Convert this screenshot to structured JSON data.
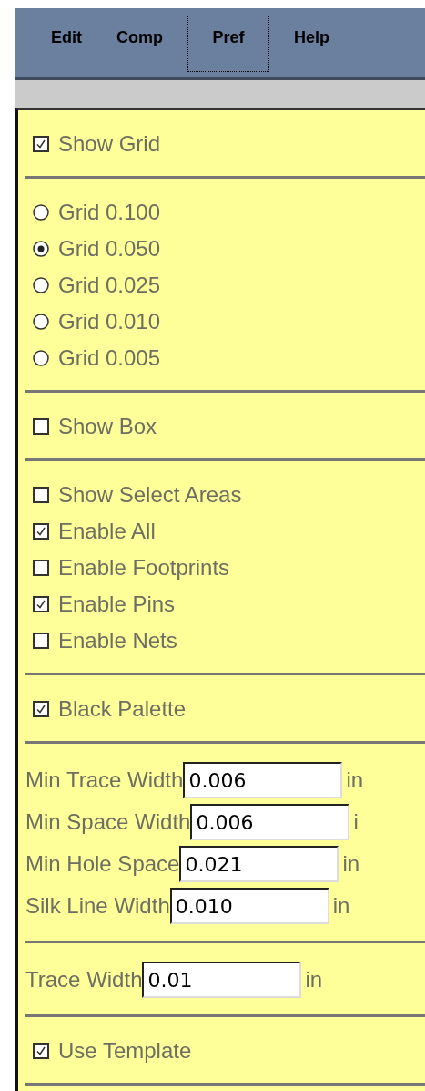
{
  "menu": [
    {
      "label": "Edit",
      "selected": false
    },
    {
      "label": "Comp",
      "selected": false
    },
    {
      "label": "Pref",
      "selected": true
    },
    {
      "label": "Help",
      "selected": false
    }
  ],
  "sections": [
    {
      "kind": "checks",
      "items": [
        {
          "label": "Show Grid",
          "checked": true
        }
      ]
    },
    {
      "kind": "radios",
      "items": [
        {
          "label": "Grid 0.100",
          "selected": false
        },
        {
          "label": "Grid 0.050",
          "selected": true
        },
        {
          "label": "Grid 0.025",
          "selected": false
        },
        {
          "label": "Grid 0.010",
          "selected": false
        },
        {
          "label": "Grid 0.005",
          "selected": false
        }
      ]
    },
    {
      "kind": "checks",
      "items": [
        {
          "label": "Show Box",
          "checked": false
        }
      ]
    },
    {
      "kind": "checks",
      "items": [
        {
          "label": "Show Select Areas",
          "checked": false
        },
        {
          "label": "Enable All",
          "checked": true
        },
        {
          "label": "Enable Footprints",
          "checked": false
        },
        {
          "label": "Enable Pins",
          "checked": true
        },
        {
          "label": "Enable Nets",
          "checked": false
        }
      ]
    },
    {
      "kind": "checks",
      "items": [
        {
          "label": "Black Palette",
          "checked": true
        }
      ]
    },
    {
      "kind": "fields",
      "items": [
        {
          "label": "Min Trace Width",
          "value": "0.006",
          "unit": "in"
        },
        {
          "label": "Min Space Width",
          "value": "0.006",
          "unit": "i"
        },
        {
          "label": "Min Hole Space",
          "value": "0.021",
          "unit": "in"
        },
        {
          "label": "Silk Line Width",
          "value": "0.010",
          "unit": "in"
        }
      ]
    },
    {
      "kind": "fields",
      "items": [
        {
          "label": "Trace Width",
          "value": "0.01",
          "unit": "in"
        }
      ]
    },
    {
      "kind": "checks",
      "items": [
        {
          "label": "Use Template",
          "checked": true
        }
      ]
    }
  ]
}
